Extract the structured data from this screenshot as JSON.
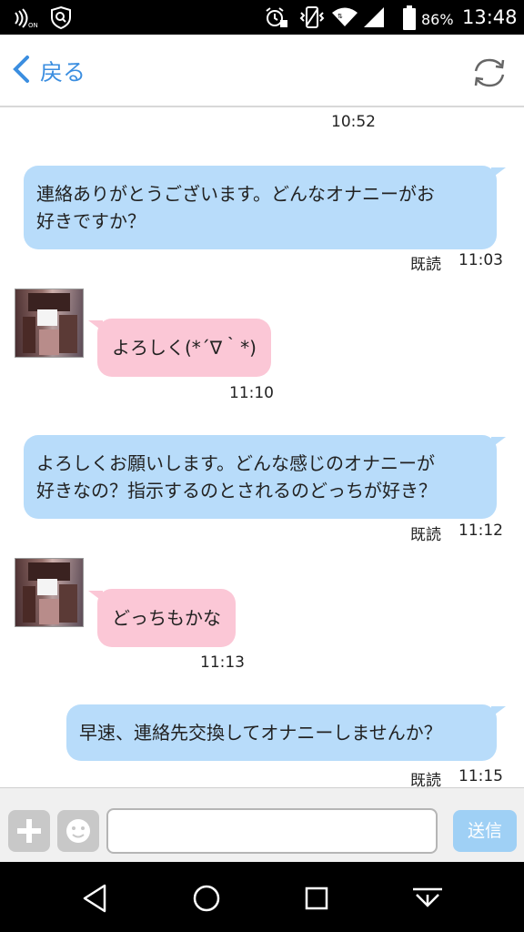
{
  "status_bar": {
    "battery_percent": "86%",
    "time": "13:48",
    "icons": [
      "nfc-on-icon",
      "security-shield-icon",
      "alarm-icon",
      "vibrate-icon",
      "wifi-icon",
      "signal-icon",
      "battery-icon"
    ]
  },
  "header": {
    "back_label": "戻る",
    "back_icon": "chevron-left-icon",
    "refresh_icon": "refresh-icon"
  },
  "messages": [
    {
      "type": "time",
      "time": "10:52"
    },
    {
      "sender": "me",
      "lines": [
        "連絡ありがとうございます。どんなオナニーがお",
        "好きですか？"
      ],
      "read": "既読",
      "time": "11:03"
    },
    {
      "sender": "other",
      "lines": [
        "よろしく(*´∇｀*)"
      ],
      "time": "11:10"
    },
    {
      "sender": "me",
      "lines": [
        "よろしくお願いします。どんな感じのオナニーが",
        "好きなの？指示するのとされるのどっちが好き？"
      ],
      "read": "既読",
      "time": "11:12"
    },
    {
      "sender": "other",
      "lines": [
        "どっちもかな"
      ],
      "time": "11:13"
    },
    {
      "sender": "me",
      "lines": [
        "早速、連絡先交換してオナニーしませんか？"
      ],
      "read": "既読",
      "time": "11:15"
    }
  ],
  "input_bar": {
    "plus_icon": "plus-icon",
    "emoji_icon": "smiley-icon",
    "text_value": "",
    "send_label": "送信"
  },
  "nav_bar": {
    "icons": [
      "back-triangle-icon",
      "home-circle-icon",
      "recents-square-icon",
      "notification-pull-icon"
    ]
  },
  "colors": {
    "accent": "#3b8ee0",
    "my_bubble": "#b8dcfa",
    "their_bubble": "#fbc7d6",
    "send_button": "#9fd0f5"
  }
}
